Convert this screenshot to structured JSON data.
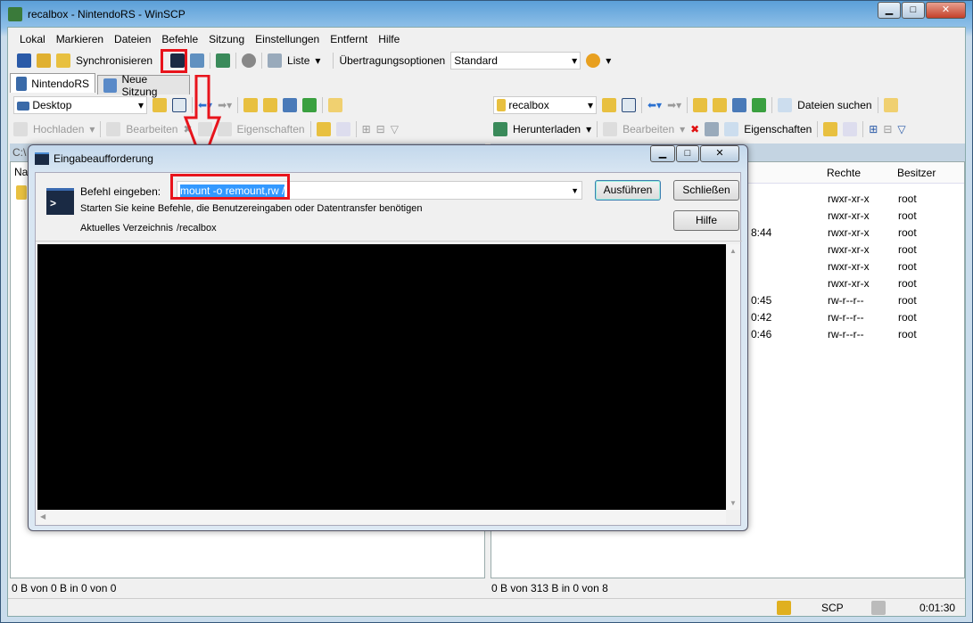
{
  "window": {
    "title": "recalbox - NintendoRS - WinSCP",
    "minimize": "▁",
    "maximize": "□",
    "close": "✕"
  },
  "menu": [
    "Lokal",
    "Markieren",
    "Dateien",
    "Befehle",
    "Sitzung",
    "Einstellungen",
    "Entfernt",
    "Hilfe"
  ],
  "toolbar": {
    "sync": "Synchronisieren",
    "view": "Liste",
    "transfer_label": "Übertragungsoptionen",
    "transfer_value": "Standard"
  },
  "tabs": [
    "NintendoRS",
    "Neue Sitzung"
  ],
  "left": {
    "path": "Desktop",
    "upload": "Hochladen",
    "edit": "Bearbeiten",
    "props": "Eigenschaften",
    "path_partial": "C:\\",
    "col_name_partial": "Na",
    "status": "0 B von 0 B in 0 von 0"
  },
  "right": {
    "path": "recalbox",
    "find": "Dateien suchen",
    "download": "Herunterladen",
    "edit": "Bearbeiten",
    "props": "Eigenschaften",
    "columns": {
      "rights": "Rechte",
      "owner": "Besitzer"
    },
    "rows": [
      {
        "time": "",
        "rights": "rwxr-xr-x",
        "owner": "root"
      },
      {
        "time": "",
        "rights": "rwxr-xr-x",
        "owner": "root"
      },
      {
        "time": "8:44",
        "rights": "rwxr-xr-x",
        "owner": "root"
      },
      {
        "time": "",
        "rights": "rwxr-xr-x",
        "owner": "root"
      },
      {
        "time": "",
        "rights": "rwxr-xr-x",
        "owner": "root"
      },
      {
        "time": "",
        "rights": "rwxr-xr-x",
        "owner": "root"
      },
      {
        "time": "0:45",
        "rights": "rw-r--r--",
        "owner": "root"
      },
      {
        "time": "0:42",
        "rights": "rw-r--r--",
        "owner": "root"
      },
      {
        "time": "0:46",
        "rights": "rw-r--r--",
        "owner": "root"
      }
    ],
    "status": "0 B von 313 B in 0 von 8"
  },
  "statusbar": {
    "protocol": "SCP",
    "time": "0:01:30"
  },
  "dialog": {
    "title": "Eingabeaufforderung",
    "cmd_label": "Befehl eingeben:",
    "cmd_value": "mount -o remount,rw /",
    "hint": "Starten Sie keine Befehle, die Benutzereingaben oder Datentransfer benötigen",
    "dir_label": "Aktuelles Verzeichnis",
    "dir_value": "/recalbox",
    "run": "Ausführen",
    "close": "Schließen",
    "help": "Hilfe"
  },
  "colors": {
    "annotation": "#e8141c",
    "selection": "#3399ff"
  }
}
